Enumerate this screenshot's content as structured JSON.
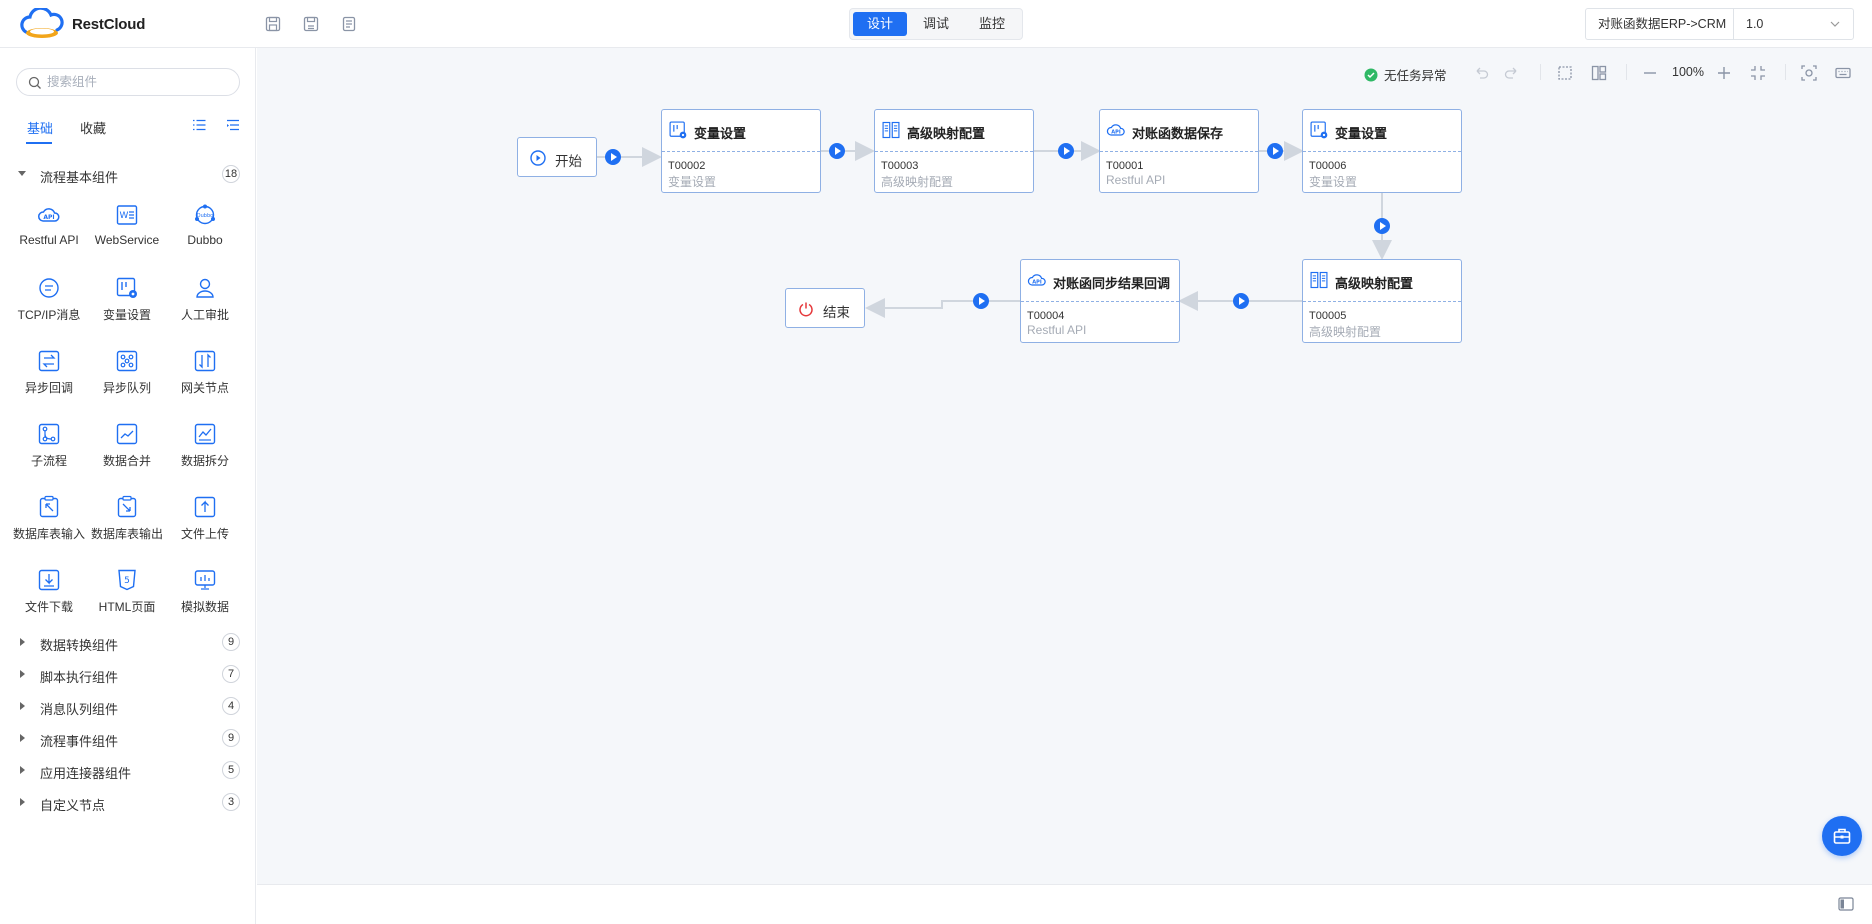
{
  "app": {
    "logo_text": "RestCloud"
  },
  "topbar": {
    "tools": [
      "save-icon",
      "save-as-icon",
      "document-icon"
    ],
    "modes": [
      "设计",
      "调试",
      "监控"
    ],
    "active_mode": "设计",
    "flow_name": "对账函数据ERP->CRM",
    "flow_version": "1.0"
  },
  "sidebar": {
    "search_placeholder": "搜索组件",
    "tabs": [
      "基础",
      "收藏"
    ],
    "active_tab": "基础",
    "basic_group": {
      "label": "流程基本组件",
      "count": "18"
    },
    "components": [
      {
        "name": "Restful API",
        "icon": "api-cloud-icon"
      },
      {
        "name": "WebService",
        "icon": "webservice-icon"
      },
      {
        "name": "Dubbo",
        "icon": "dubbo-icon"
      },
      {
        "name": "TCP/IP消息",
        "icon": "tcp-message-icon"
      },
      {
        "name": "变量设置",
        "icon": "variable-settings-icon"
      },
      {
        "name": "人工审批",
        "icon": "user-approval-icon"
      },
      {
        "name": "异步回调",
        "icon": "async-callback-icon"
      },
      {
        "name": "异步队列",
        "icon": "async-queue-icon"
      },
      {
        "name": "网关节点",
        "icon": "gateway-icon"
      },
      {
        "name": "子流程",
        "icon": "subprocess-icon"
      },
      {
        "name": "数据合并",
        "icon": "data-merge-icon"
      },
      {
        "name": "数据拆分",
        "icon": "data-split-icon"
      },
      {
        "name": "数据库表输入",
        "icon": "db-input-icon"
      },
      {
        "name": "数据库表输出",
        "icon": "db-output-icon"
      },
      {
        "name": "文件上传",
        "icon": "file-upload-icon"
      },
      {
        "name": "文件下载",
        "icon": "file-download-icon"
      },
      {
        "name": "HTML页面",
        "icon": "html5-icon"
      },
      {
        "name": "模拟数据",
        "icon": "mock-data-icon"
      }
    ],
    "groups": [
      {
        "label": "数据转换组件",
        "count": "9"
      },
      {
        "label": "脚本执行组件",
        "count": "7"
      },
      {
        "label": "消息队列组件",
        "count": "4"
      },
      {
        "label": "流程事件组件",
        "count": "9"
      },
      {
        "label": "应用连接器组件",
        "count": "5"
      },
      {
        "label": "自定义节点",
        "count": "3"
      }
    ]
  },
  "canvas": {
    "status_text": "无任务异常",
    "zoom": "100%",
    "start_label": "开始",
    "end_label": "结束",
    "nodes": [
      {
        "title": "变量设置",
        "code": "T00002",
        "desc": "变量设置",
        "icon": "variable-settings-icon"
      },
      {
        "title": "高级映射配置",
        "code": "T00003",
        "desc": "高级映射配置",
        "icon": "mapping-icon"
      },
      {
        "title": "对账函数据保存",
        "code": "T00001",
        "desc": "Restful API",
        "icon": "api-cloud-icon"
      },
      {
        "title": "变量设置",
        "code": "T00006",
        "desc": "变量设置",
        "icon": "variable-settings-icon"
      },
      {
        "title": "高级映射配置",
        "code": "T00005",
        "desc": "高级映射配置",
        "icon": "mapping-icon"
      },
      {
        "title": "对账函同步结果回调",
        "code": "T00004",
        "desc": "Restful API",
        "icon": "api-cloud-icon"
      }
    ]
  },
  "colors": {
    "primary": "#1f6ff2",
    "node_border": "#8fb0e4",
    "success": "#2fb865",
    "danger": "#e5383b"
  }
}
